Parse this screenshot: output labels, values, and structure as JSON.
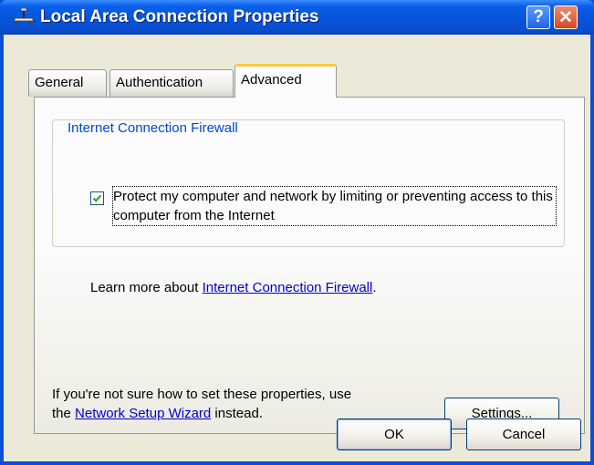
{
  "window": {
    "title": "Local Area Connection Properties",
    "help_label": "?",
    "close_label": "✕"
  },
  "tabs": [
    {
      "label": "General",
      "selected": false
    },
    {
      "label": "Authentication",
      "selected": false
    },
    {
      "label": "Advanced",
      "selected": true
    }
  ],
  "firewall": {
    "group_title": "Internet Connection Firewall",
    "checkbox_label": "Protect my computer and network by limiting or preventing access to this computer from the Internet",
    "checked": true,
    "learn_prefix": "Learn more about ",
    "learn_link": "Internet Connection Firewall",
    "learn_suffix": "."
  },
  "wizard": {
    "text_line1": "If you're not sure how to set these properties, use",
    "text_prefix": "the ",
    "link": "Network Setup Wizard",
    "text_suffix": " instead.",
    "settings_label": "Settings..."
  },
  "footer": {
    "ok_label": "OK",
    "cancel_label": "Cancel"
  },
  "colors": {
    "titlebar": "#0554d8",
    "accent_tab": "#ffc83c",
    "group_title": "#0046d5",
    "link": "#0000cc"
  }
}
